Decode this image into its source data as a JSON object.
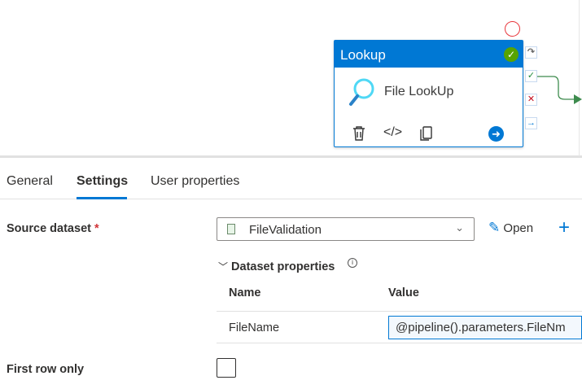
{
  "activity": {
    "type": "Lookup",
    "name": "File LookUp"
  },
  "tabs": [
    {
      "label": "General"
    },
    {
      "label": "Settings",
      "active": true
    },
    {
      "label": "User properties"
    }
  ],
  "settings": {
    "source_dataset_label": "Source dataset",
    "required_mark": "*",
    "source_dataset_value": "FileValidation",
    "open_label": "Open",
    "dataset_properties_label": "Dataset properties",
    "columns": {
      "name": "Name",
      "value": "Value"
    },
    "properties": [
      {
        "name": "FileName",
        "value": "@pipeline().parameters.FileNm"
      }
    ],
    "first_row_only_label": "First row only",
    "first_row_only": false
  },
  "colors": {
    "accent": "#0078d4",
    "success": "#57a300",
    "error": "#e8373c"
  }
}
